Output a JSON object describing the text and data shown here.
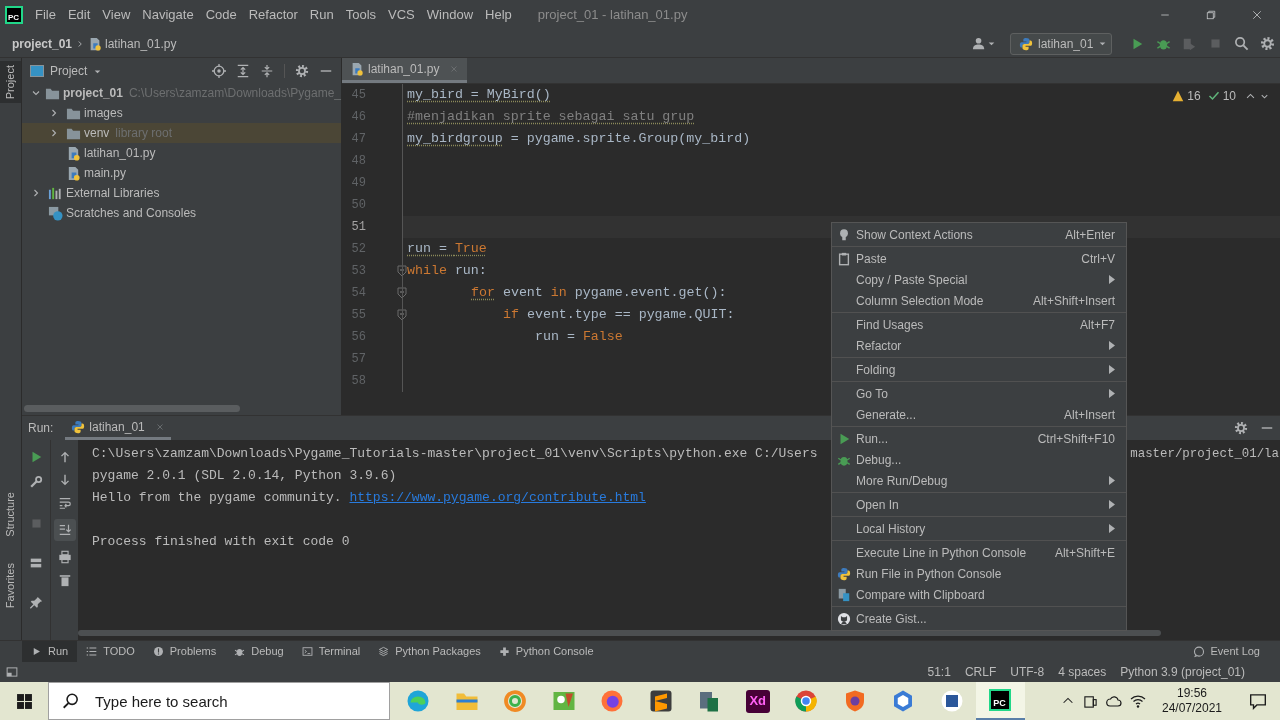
{
  "title_bar": {
    "logo": "PC",
    "menus": [
      "File",
      "Edit",
      "View",
      "Navigate",
      "Code",
      "Refactor",
      "Run",
      "Tools",
      "VCS",
      "Window",
      "Help"
    ],
    "title": "project_01 - latihan_01.py"
  },
  "nav_bar": {
    "breadcrumbs": [
      "project_01",
      "latihan_01.py"
    ],
    "run_config": "latihan_01"
  },
  "side_strip": {
    "top": [
      {
        "label": "Project",
        "selected": true
      }
    ],
    "bottom": [
      {
        "label": "Structure",
        "selected": false
      },
      {
        "label": "Favorites",
        "selected": false
      }
    ]
  },
  "project_panel": {
    "title": "Project",
    "tree": [
      {
        "label": "project_01",
        "hint": "C:\\Users\\zamzam\\Downloads\\Pygame_",
        "kind": "folder",
        "expanded": true,
        "selected": false,
        "children": [
          {
            "label": "images",
            "kind": "folder",
            "expanded": false,
            "selected": false
          },
          {
            "label": "venv",
            "hint": "library root",
            "kind": "folder",
            "expanded": false,
            "selected": true
          },
          {
            "label": "latihan_01.py",
            "kind": "python",
            "selected": false
          },
          {
            "label": "main.py",
            "kind": "python",
            "selected": false
          }
        ]
      },
      {
        "label": "External Libraries",
        "kind": "library",
        "expanded": false,
        "selected": false
      },
      {
        "label": "Scratches and Consoles",
        "kind": "scratch",
        "selected": false
      }
    ]
  },
  "editor": {
    "tab": {
      "label": "latihan_01.py",
      "selected": true
    },
    "inspections": {
      "warnings": "16",
      "ok": "10"
    },
    "lines": [
      {
        "number": "45",
        "current": false,
        "tokens": [
          {
            "text": "my_bird = MyBird()",
            "kind": "plain",
            "warn": true
          }
        ]
      },
      {
        "number": "46",
        "current": false,
        "tokens": [
          {
            "text": "#menjadikan sprite sebagai satu grup",
            "kind": "comment",
            "warn": true
          }
        ]
      },
      {
        "number": "47",
        "current": false,
        "tokens": [
          {
            "text": "my_birdgroup",
            "kind": "plain",
            "warn": true
          },
          {
            "text": " = pygame.sprite.Group(my_bird)",
            "kind": "plain",
            "warn": false
          }
        ]
      },
      {
        "number": "48",
        "current": false
      },
      {
        "number": "49",
        "current": false
      },
      {
        "number": "50",
        "current": false
      },
      {
        "number": "51",
        "current": true
      },
      {
        "number": "52",
        "current": false,
        "tokens": [
          {
            "text": "run = ",
            "kind": "plain",
            "warn": true
          },
          {
            "text": "True",
            "kind": "keyword",
            "warn": true
          }
        ]
      },
      {
        "number": "53",
        "current": false,
        "tokens": [
          {
            "text": "while",
            "kind": "keyword",
            "warn": false
          },
          {
            "text": " run:",
            "kind": "plain",
            "warn": false
          }
        ],
        "children": [
          {
            "number": "54",
            "current": false,
            "tokens": [
              {
                "text": "for",
                "kind": "keyword",
                "warn": true
              },
              {
                "text": " event ",
                "kind": "plain",
                "warn": false
              },
              {
                "text": "in",
                "kind": "keyword",
                "warn": false
              },
              {
                "text": " pygame.event.get():",
                "kind": "plain",
                "warn": false
              }
            ],
            "children": [
              {
                "number": "55",
                "current": false,
                "tokens": [
                  {
                    "text": "if",
                    "kind": "keyword",
                    "warn": false
                  },
                  {
                    "text": " event.type == pygame.QUIT:",
                    "kind": "plain",
                    "warn": false
                  }
                ],
                "children": [
                  {
                    "number": "56",
                    "current": false,
                    "tokens": [
                      {
                        "text": "run = ",
                        "kind": "plain",
                        "warn": false
                      },
                      {
                        "text": "False",
                        "kind": "keyword",
                        "warn": false
                      }
                    ]
                  }
                ]
              }
            ]
          }
        ]
      },
      {
        "number": "57",
        "current": false
      },
      {
        "number": "58",
        "current": false
      }
    ]
  },
  "run_panel": {
    "label": "Run:",
    "tab": {
      "label": "latihan_01",
      "selected": true
    },
    "console": [
      {
        "kind": "output",
        "parts": [
          {
            "text": "C:\\Users\\zamzam\\Downloads\\Pygame_Tutorials-master\\project_01\\venv\\Scripts\\python.exe C:/Users",
            "kind": "plain"
          }
        ],
        "tail": "master/project_01/la"
      },
      {
        "kind": "output",
        "parts": [
          {
            "text": "pygame 2.0.1 (SDL 2.0.14, Python 3.9.6)",
            "kind": "plain"
          }
        ]
      },
      {
        "kind": "output",
        "parts": [
          {
            "text": "Hello from the pygame community. ",
            "kind": "plain"
          },
          {
            "text": "https://www.pygame.org/contribute.html",
            "kind": "link"
          }
        ]
      },
      {
        "kind": "exit",
        "parts": [
          {
            "text": "Process finished with exit code 0",
            "kind": "plain"
          }
        ]
      }
    ]
  },
  "context_menu": {
    "groups": [
      {
        "items": [
          {
            "label": "Show Context Actions",
            "shortcut": "Alt+Enter",
            "kind": "bulb",
            "submenu": false
          }
        ]
      },
      {
        "items": [
          {
            "label": "Paste",
            "shortcut": "Ctrl+V",
            "kind": "paste",
            "submenu": false
          },
          {
            "label": "Copy / Paste Special",
            "kind": "plain",
            "submenu": true
          },
          {
            "label": "Column Selection Mode",
            "shortcut": "Alt+Shift+Insert",
            "kind": "plain",
            "submenu": false
          }
        ]
      },
      {
        "items": [
          {
            "label": "Find Usages",
            "shortcut": "Alt+F7",
            "kind": "plain",
            "submenu": false
          },
          {
            "label": "Refactor",
            "kind": "plain",
            "submenu": true
          }
        ]
      },
      {
        "items": [
          {
            "label": "Folding",
            "kind": "plain",
            "submenu": true
          }
        ]
      },
      {
        "items": [
          {
            "label": "Go To",
            "kind": "plain",
            "submenu": true
          },
          {
            "label": "Generate...",
            "shortcut": "Alt+Insert",
            "kind": "plain",
            "submenu": false
          }
        ]
      },
      {
        "items": [
          {
            "label": "Run...",
            "shortcut": "Ctrl+Shift+F10",
            "kind": "run",
            "submenu": false
          },
          {
            "label": "Debug...",
            "kind": "debug",
            "submenu": false
          },
          {
            "label": "More Run/Debug",
            "kind": "plain",
            "submenu": true
          }
        ]
      },
      {
        "items": [
          {
            "label": "Open In",
            "kind": "plain",
            "submenu": true
          }
        ]
      },
      {
        "items": [
          {
            "label": "Local History",
            "kind": "plain",
            "submenu": true
          }
        ]
      },
      {
        "items": [
          {
            "label": "Execute Line in Python Console",
            "shortcut": "Alt+Shift+E",
            "kind": "plain",
            "submenu": false
          },
          {
            "label": "Run File in Python Console",
            "kind": "python",
            "submenu": false
          },
          {
            "label": "Compare with Clipboard",
            "kind": "compare",
            "submenu": false
          }
        ]
      },
      {
        "items": [
          {
            "label": "Create Gist...",
            "kind": "gist",
            "submenu": false
          }
        ]
      }
    ]
  },
  "bottom_tabs": [
    {
      "label": "Run",
      "kind": "run",
      "selected": true
    },
    {
      "label": "TODO",
      "kind": "todo",
      "selected": false
    },
    {
      "label": "Problems",
      "kind": "problems",
      "selected": false
    },
    {
      "label": "Debug",
      "kind": "debug",
      "selected": false
    },
    {
      "label": "Terminal",
      "kind": "terminal",
      "selected": false
    },
    {
      "label": "Python Packages",
      "kind": "packages",
      "selected": false
    },
    {
      "label": "Python Console",
      "kind": "python",
      "selected": false
    }
  ],
  "event_log": "Event Log",
  "status_bar": [
    "51:1",
    "CRLF",
    "UTF-8",
    "4 spaces",
    "Python 3.9 (project_01)"
  ],
  "taskbar": {
    "search_placeholder": "Type here to search",
    "apps": [
      {
        "kind": "edge",
        "selected": false
      },
      {
        "kind": "folder",
        "selected": false
      },
      {
        "kind": "ring",
        "selected": false
      },
      {
        "kind": "image",
        "selected": false
      },
      {
        "kind": "firefox",
        "selected": false
      },
      {
        "kind": "sublime",
        "selected": false
      },
      {
        "kind": "files",
        "selected": false
      },
      {
        "kind": "xd",
        "label": "Xd",
        "selected": false
      },
      {
        "kind": "chrome",
        "selected": false
      },
      {
        "kind": "shield",
        "selected": false
      },
      {
        "kind": "hex",
        "selected": false
      },
      {
        "kind": "word",
        "selected": false
      },
      {
        "kind": "pycharm",
        "label": "PC",
        "selected": true
      }
    ],
    "time": "19:56",
    "date": "24/07/2021"
  }
}
